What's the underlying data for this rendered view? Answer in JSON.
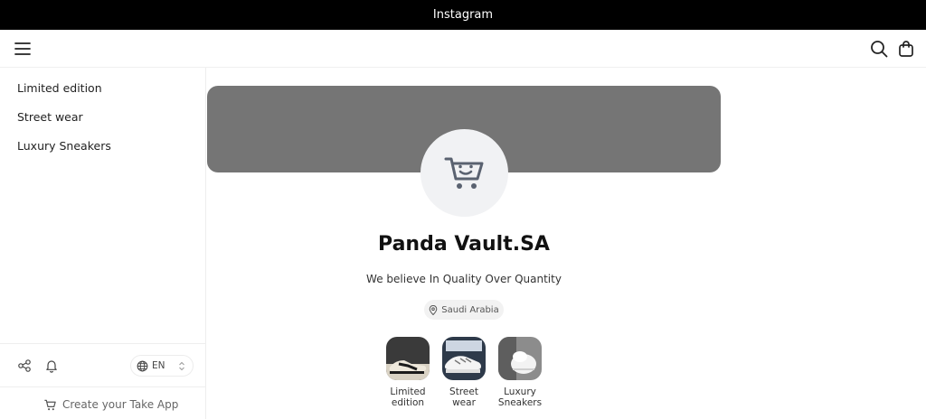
{
  "topbar": {
    "title": "Instagram"
  },
  "sidebar": {
    "items": [
      {
        "label": "Limited edition"
      },
      {
        "label": "Street wear"
      },
      {
        "label": "Luxury Sneakers"
      }
    ],
    "language": "EN",
    "create_label": "Create your Take App"
  },
  "profile": {
    "name": "Panda Vault.SA",
    "tagline": "We believe In Quality Over Quantity",
    "location": "Saudi Arabia"
  },
  "categories": [
    {
      "label": "Limited edition"
    },
    {
      "label": "Street wear"
    },
    {
      "label": "Luxury Sneakers"
    }
  ],
  "colors": {
    "cover": "#757575",
    "topbar": "#000000",
    "avatar_bg": "#f1f2f4",
    "icon": "#5a6270"
  },
  "icons": [
    "menu-icon",
    "search-icon",
    "shopping-bag-icon",
    "share-icon",
    "bell-icon",
    "globe-icon",
    "cart-icon",
    "location-pin-icon"
  ]
}
